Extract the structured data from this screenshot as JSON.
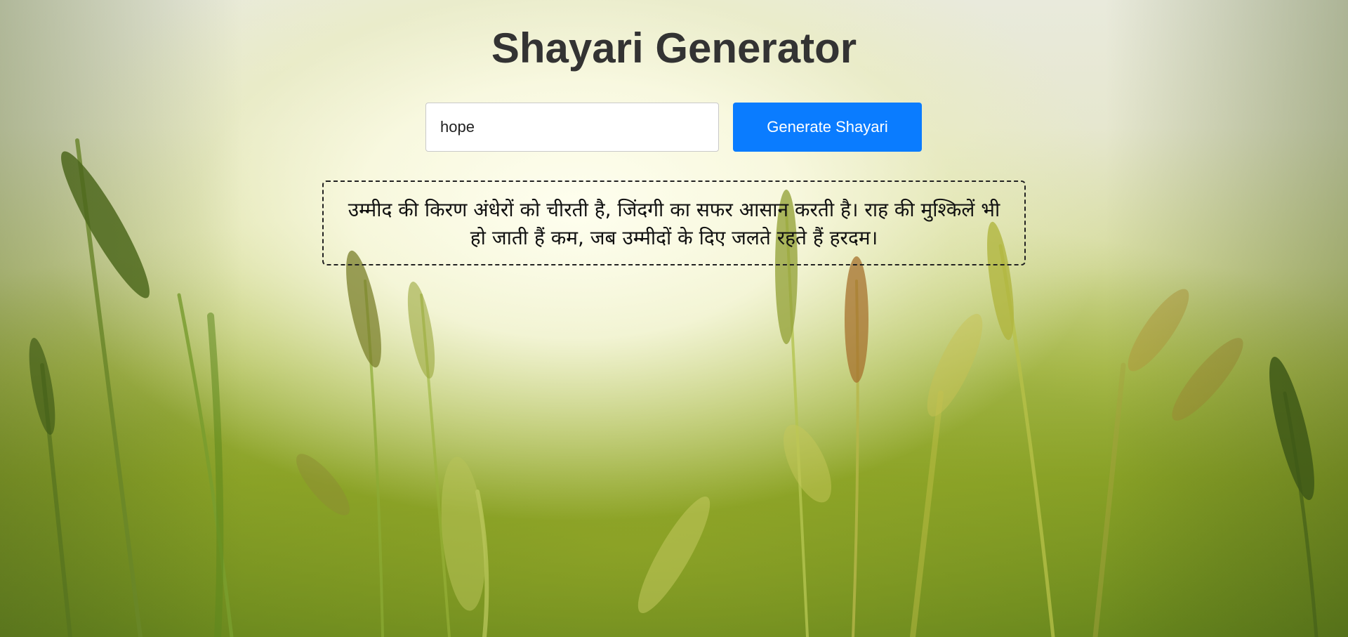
{
  "page": {
    "title": "Shayari Generator"
  },
  "search": {
    "value": "hope"
  },
  "generate_button": {
    "label": "Generate Shayari"
  },
  "shayari": {
    "text": "उम्मीद की किरण अंधेरों को चीरती है, जिंदगी का सफर आसान करती है। राह की मुश्किलें भी हो जाती हैं कम, जब उम्मीदों के दिए जलते रहते हैं हरदम।"
  },
  "colors": {
    "accent": "#0a7cff",
    "title": "#333333"
  },
  "background": {
    "icon": "wheat-field-image"
  }
}
